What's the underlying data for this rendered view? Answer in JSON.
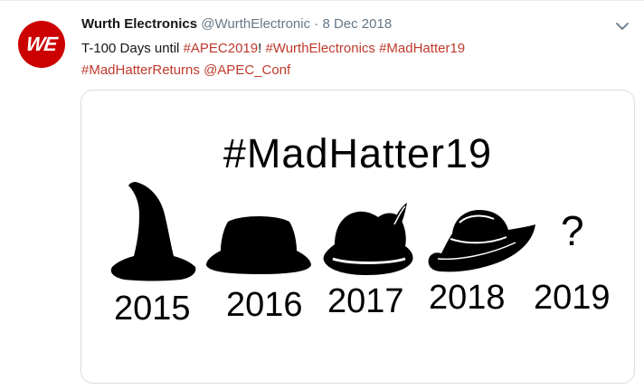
{
  "tweet": {
    "author_name": "Wurth Electronics",
    "author_handle": "@WurthElectronic",
    "separator": "·",
    "date": "8 Dec 2018",
    "avatar_text": "WE",
    "text_prefix": "T-100 Days until ",
    "hashtag_apec": "#APEC2019",
    "exclaim": "!",
    "hashtag_wurth": "#WurthElectronics",
    "hashtag_madhatter": "#MadHatter19",
    "hashtag_returns": "#MadHatterReturns",
    "mention_apec": "@APEC_Conf"
  },
  "media": {
    "title": "#MadHatter19",
    "hats": [
      {
        "icon": "witch-hat-icon",
        "year": "2015"
      },
      {
        "icon": "fedora-hat-icon",
        "year": "2016"
      },
      {
        "icon": "alpine-hat-icon",
        "year": "2017"
      },
      {
        "icon": "cowboy-hat-icon",
        "year": "2018"
      },
      {
        "icon": "question-mark-icon",
        "year": "2019",
        "symbol": "?"
      }
    ]
  },
  "colors": {
    "brand_red": "#cc0000",
    "link_red": "#c0392b",
    "muted": "#657786"
  }
}
